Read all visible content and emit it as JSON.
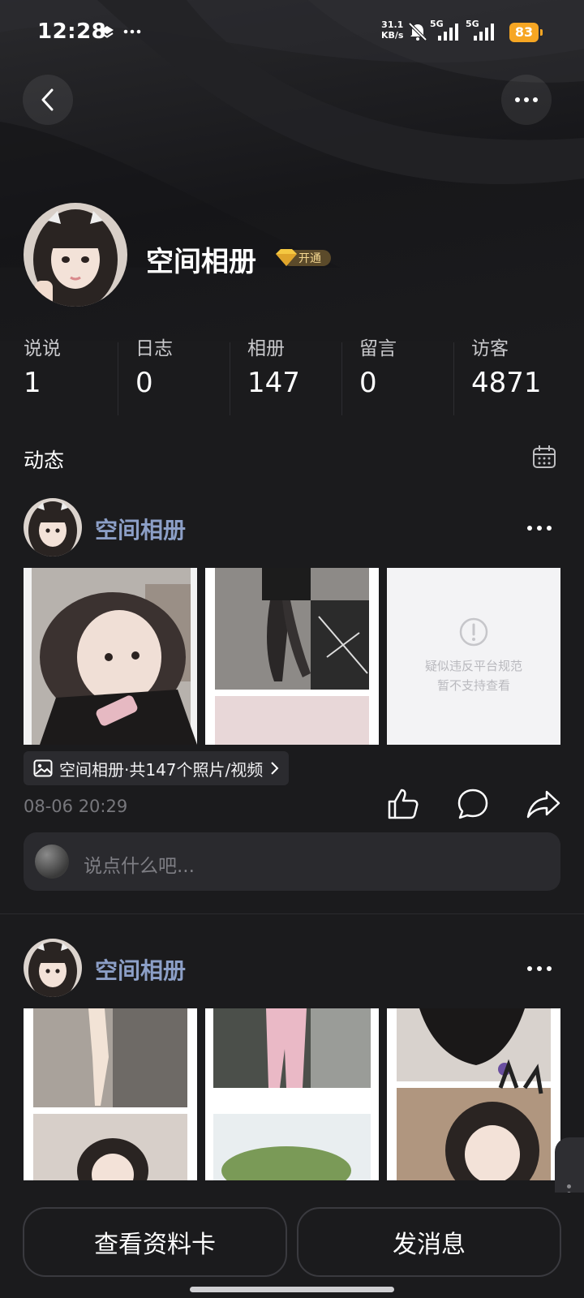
{
  "status_bar": {
    "time": "12:28",
    "net_speed_value": "31.1",
    "net_speed_unit": "KB/s",
    "signal_1": "5G",
    "signal_2": "5G",
    "battery": "83"
  },
  "profile": {
    "name": "空间相册",
    "vip_label": "开通"
  },
  "stats": [
    {
      "label": "说说",
      "value": "1"
    },
    {
      "label": "日志",
      "value": "0"
    },
    {
      "label": "相册",
      "value": "147"
    },
    {
      "label": "留言",
      "value": "0"
    },
    {
      "label": "访客",
      "value": "4871"
    }
  ],
  "section": {
    "title": "动态"
  },
  "feed": [
    {
      "author": "空间相册",
      "blocked_line1": "疑似违反平台规范",
      "blocked_line2": "暂不支持查看",
      "album_chip": "空间相册·共147个照片/视频",
      "time": "08-06 20:29",
      "comment_placeholder": "说点什么吧..."
    },
    {
      "author": "空间相册"
    }
  ],
  "bottom": {
    "profile_card": "查看资料卡",
    "send_message": "发消息"
  },
  "colors": {
    "background": "#1b1b1d",
    "author_name": "#8c9fc7",
    "battery": "#f6a623",
    "vip_gold": "#f5c842"
  }
}
